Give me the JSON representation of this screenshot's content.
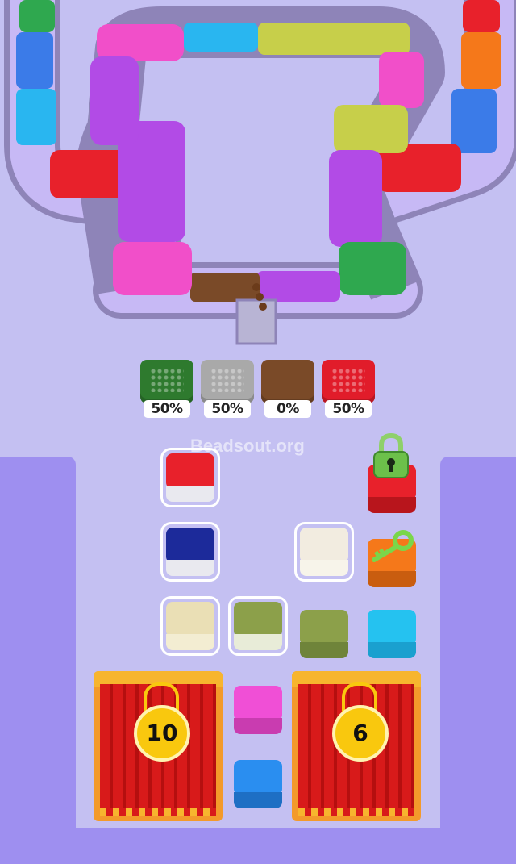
{
  "watermark": "Beadsout.org",
  "trays": [
    {
      "color": "#2e7a2e",
      "percent": "50%"
    },
    {
      "color": "#a9a9a9",
      "percent": "50%"
    },
    {
      "color": "#7a4a28",
      "percent": "0%"
    },
    {
      "color": "#e11c2a",
      "percent": "50%"
    }
  ],
  "boxes": [
    {
      "color": "#e8212b",
      "selected": true
    },
    {
      "color": "#1c2a9a",
      "selected": true
    },
    {
      "color": "#f2ece0",
      "selected": true
    },
    {
      "color": "#eadfb5",
      "selected": true
    },
    {
      "color": "#8ca04a",
      "selected": true
    },
    {
      "color": "#8ca04a",
      "selected": false
    },
    {
      "color": "#25c2f0",
      "selected": false
    },
    {
      "color": "#f04fd6",
      "selected": false
    },
    {
      "color": "#2a8ef0",
      "selected": false
    },
    {
      "color": "#e8212b",
      "selected": false,
      "locked": true,
      "lock_icon": "lock-icon"
    },
    {
      "color": "#f5781a",
      "selected": false,
      "key_icon": "key-icon"
    }
  ],
  "curtains": [
    {
      "count": "10"
    },
    {
      "count": "6"
    }
  ],
  "track_colors": [
    "#2fa84f",
    "#3b7be8",
    "#29b6f0",
    "#e8212b",
    "#b24be6",
    "#f14fc9",
    "#7a4a28",
    "#8ed444",
    "#f5781a",
    "#26c6e6",
    "#f0c83a"
  ]
}
